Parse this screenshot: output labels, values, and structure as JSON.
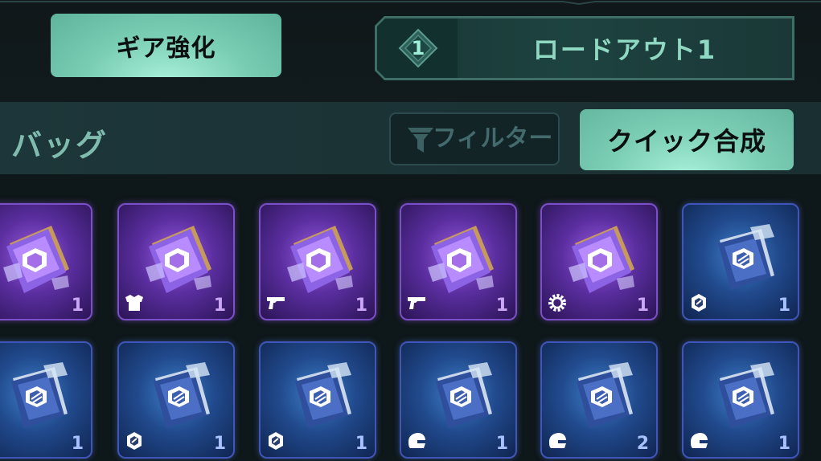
{
  "header": {
    "gear_button_label": "ギア強化",
    "loadout": {
      "number": "1",
      "label": "ロードアウト1"
    }
  },
  "bag": {
    "title": "バッグ",
    "filter_label": "フィルター",
    "quick_button_label": "クイック合成"
  },
  "colors": {
    "accent": "#7fd4bb",
    "purple_rarity": "#7b4fc6",
    "blue_rarity": "#3f56b8"
  },
  "items": [
    {
      "rarity": "purple",
      "type_icon": "shoe-icon",
      "count": "1"
    },
    {
      "rarity": "purple",
      "type_icon": "armor-icon",
      "count": "1"
    },
    {
      "rarity": "purple",
      "type_icon": "gun-icon",
      "count": "1"
    },
    {
      "rarity": "purple",
      "type_icon": "gun-icon",
      "count": "1"
    },
    {
      "rarity": "purple",
      "type_icon": "cog-icon",
      "count": "1"
    },
    {
      "rarity": "blue",
      "type_icon": "gem-icon",
      "count": "1"
    },
    {
      "rarity": "blue",
      "type_icon": "gem-icon",
      "count": "1"
    },
    {
      "rarity": "blue",
      "type_icon": "gem-icon",
      "count": "1"
    },
    {
      "rarity": "blue",
      "type_icon": "gem-icon",
      "count": "1"
    },
    {
      "rarity": "blue",
      "type_icon": "helmet-icon",
      "count": "1"
    },
    {
      "rarity": "blue",
      "type_icon": "helmet-icon",
      "count": "2"
    },
    {
      "rarity": "blue",
      "type_icon": "helmet-icon",
      "count": "1"
    }
  ]
}
